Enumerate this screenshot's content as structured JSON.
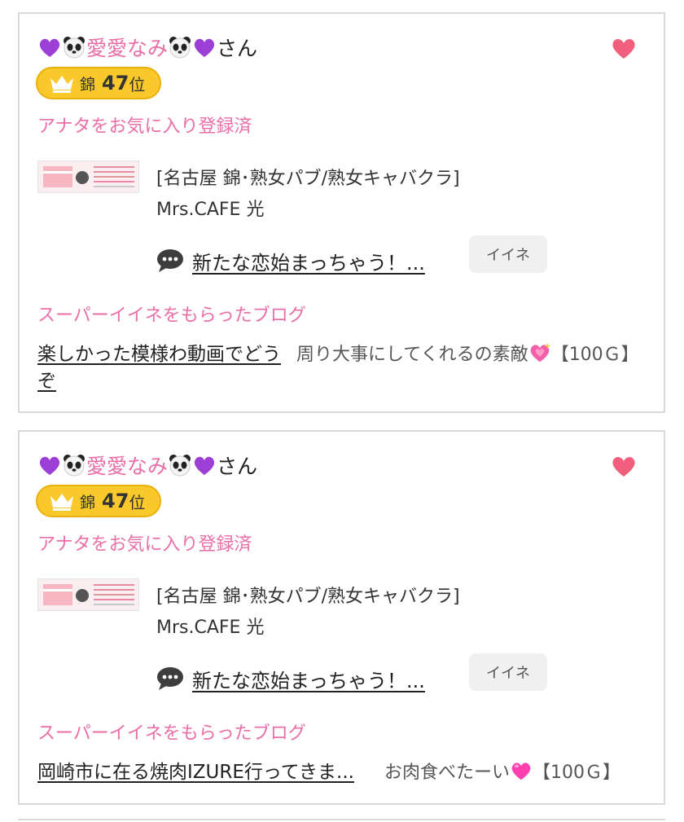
{
  "colors": {
    "accent_pink": "#ea6fa8",
    "badge_gold": "#f9c92b",
    "heart": "#f25f7c"
  },
  "cards": [
    {
      "user_name": "愛愛なみ",
      "honorific": "さん",
      "rank_area": "錦",
      "rank_number": "47",
      "rank_unit": "位",
      "favorite_status": "アナタをお気に入り登録済",
      "shop_area": "[名古屋 錦･熟女パブ/熟女キャバクラ]",
      "shop_name": "Mrs.CAFE 光",
      "post_title": "新たな恋始まっちゃう！...",
      "like_label": "イイネ",
      "super_like_title": "スーパーイイネをもらったブログ",
      "blog_title": "楽しかった模様わ動画でどうぞ",
      "comment_text": "周り大事にしてくれるの素敵",
      "comment_emoji": "sparkling-heart-icon",
      "comment_points": "【100Ｇ】"
    },
    {
      "user_name": "愛愛なみ",
      "honorific": "さん",
      "rank_area": "錦",
      "rank_number": "47",
      "rank_unit": "位",
      "favorite_status": "アナタをお気に入り登録済",
      "shop_area": "[名古屋 錦･熟女パブ/熟女キャバクラ]",
      "shop_name": "Mrs.CAFE 光",
      "post_title": "新たな恋始まっちゃう！...",
      "like_label": "イイネ",
      "super_like_title": "スーパーイイネをもらったブログ",
      "blog_title": "岡崎市に在る焼肉IZURE行ってきま...",
      "comment_text": "お肉食べたーい",
      "comment_emoji": "pink-heart-icon",
      "comment_points": "【100Ｇ】"
    }
  ]
}
